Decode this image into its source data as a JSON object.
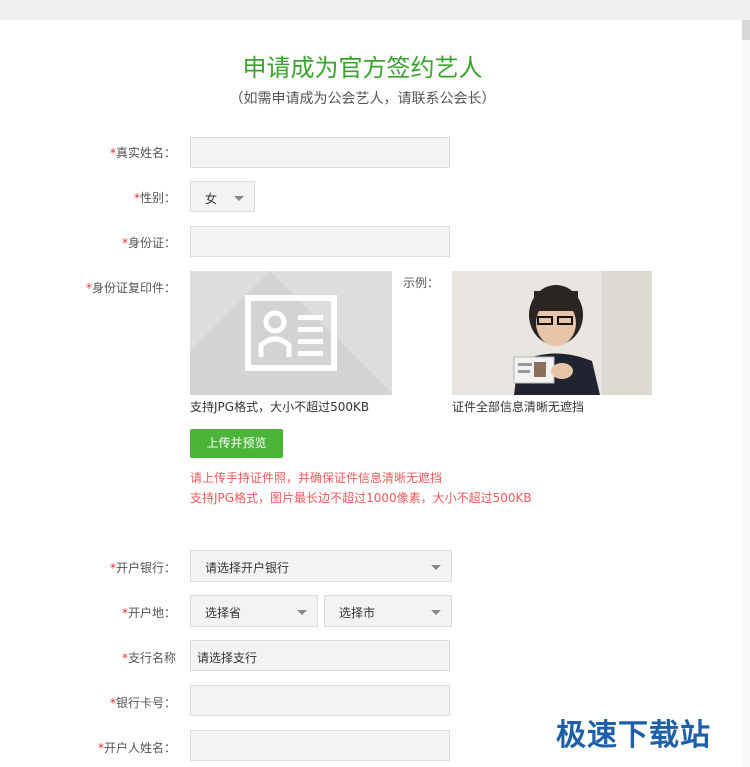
{
  "page": {
    "title": "申请成为官方签约艺人",
    "subtitle": "（如需申请成为公会艺人，请联系公会长）"
  },
  "form": {
    "required_mark": "*",
    "real_name": {
      "label": "真实姓名：",
      "value": ""
    },
    "gender": {
      "label": "性别：",
      "value": "女"
    },
    "id_number": {
      "label": "身份证：",
      "value": ""
    },
    "id_copy": {
      "label": "身份证复印件：",
      "upload_caption": "支持JPG格式，大小不超过500KB",
      "example_label": "示例：",
      "example_caption": "证件全部信息清晰无遮挡",
      "upload_button": "上传并预览",
      "tips": [
        "请上传手持证件照，并确保证件信息清晰无遮挡",
        "支持JPG格式，图片最长边不超过1000像素，大小不超过500KB"
      ]
    },
    "bank": {
      "label": "开户银行：",
      "value": "请选择开户银行"
    },
    "bank_location": {
      "label": "开户地：",
      "province": "选择省",
      "city": "选择市"
    },
    "branch": {
      "label": "支行名称",
      "value": "请选择支行"
    },
    "card_number": {
      "label": "银行卡号：",
      "value": ""
    },
    "account_name": {
      "label": "开户人姓名：",
      "value": ""
    }
  },
  "watermark": {
    "text": "极速下载站",
    "color": "#1d5fa8"
  },
  "colors": {
    "accent": "#3aa22d",
    "button": "#4bb539",
    "tip": "#f05a5a",
    "required": "#e53333"
  }
}
